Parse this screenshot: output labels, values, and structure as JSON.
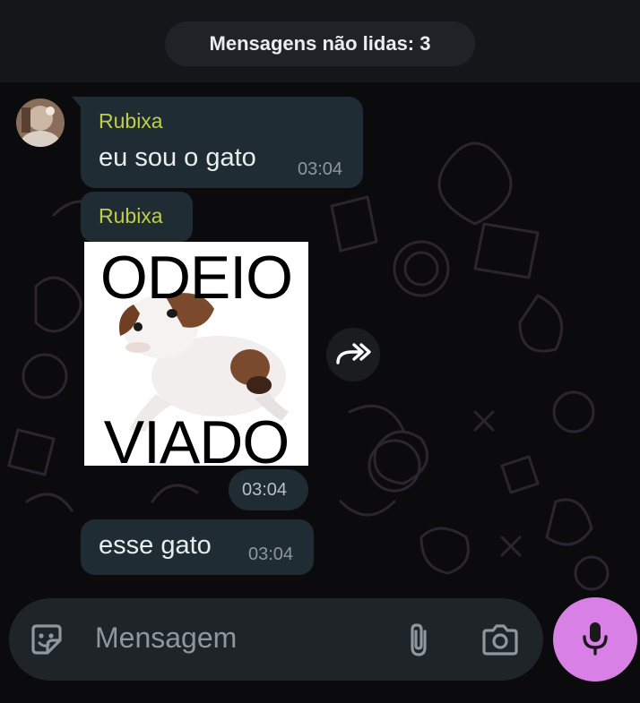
{
  "unread": {
    "label": "Mensagens não lidas: 3"
  },
  "messages": [
    {
      "sender": "Rubixa",
      "text": "eu sou o gato",
      "time": "03:04"
    },
    {
      "sender": "Rubixa",
      "sticker_top": "ODEIO",
      "sticker_bottom": "VIADO",
      "time": "03:04"
    },
    {
      "text": "esse gato",
      "time": "03:04"
    }
  ],
  "composer": {
    "placeholder": "Mensagem"
  },
  "icons": {
    "emoji": "sticker-icon",
    "attach": "paperclip-icon",
    "camera": "camera-icon",
    "send": "microphone-icon",
    "forward": "forward-icon"
  },
  "colors": {
    "background": "#0b0b0d",
    "bubble": "#202c33",
    "sender_name": "#c0cf43",
    "timestamp": "#8e979d",
    "mic_button": "#d980e6"
  }
}
